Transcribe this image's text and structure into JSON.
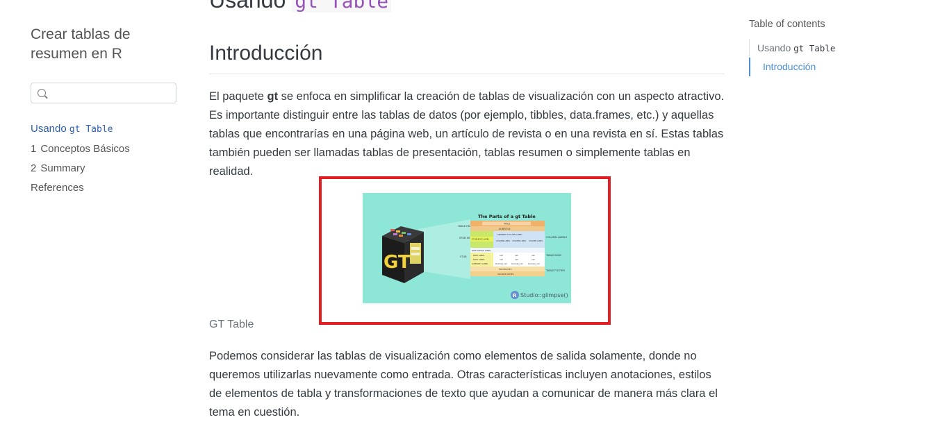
{
  "sidebar": {
    "title": "Crear tablas de resumen en R",
    "search_placeholder": "",
    "items": [
      {
        "prefix": "Usando",
        "code": "gt Table",
        "num": ""
      },
      {
        "num": "1",
        "label": "Conceptos Básicos"
      },
      {
        "num": "2",
        "label": "Summary"
      },
      {
        "num": "",
        "label": "References"
      }
    ]
  },
  "main": {
    "h1_prefix": "Usando",
    "h1_code": "gt Table",
    "h2": "Introducción",
    "p1_a": "El paquete ",
    "p1_bold": "gt",
    "p1_b": " se enfoca en simplificar la creación de tablas de visualización con un aspecto atractivo. Es importante distinguir entre las tablas de datos (por ejemplo, tibbles, data.frames, etc.) y aquellas tablas que encontrarías en una página web, un artículo de revista o en una revista en sí. Estas tablas también pueden ser llamadas tablas de presentación, tablas resumen o simplemente tablas en realidad.",
    "figure": {
      "title": "The Parts of a gt Table",
      "logo": "GT",
      "brand": "Studio::glimpse()",
      "brand_r": "R",
      "row_labels": [
        "TABLE HEADER",
        "STUB HEAD",
        "STUB"
      ],
      "col_labels": [
        "COLUMN LABELS",
        "TABLE BODY",
        "TABLE FOOTER"
      ],
      "title_cell": "TITLE",
      "subtitle_cell": "SUBTITLE",
      "stubhead_cell": "STUBHEAD LABEL",
      "spanner_cell": "SPANNER COLUMN LABEL",
      "col_cells": [
        "COLUMN LABEL",
        "COLUMN LABEL",
        "COLUMN LABEL"
      ],
      "row_group": "ROW GROUP LABEL",
      "stub_rows": [
        "ROW LABEL",
        "ROW LABEL",
        "SUMMARY LABEL"
      ],
      "cell": "cell",
      "summary_cell": "Summary cell",
      "footnotes": "FOOTNOTES",
      "source_notes": "SOURCE NOTES"
    },
    "caption": "GT Table",
    "p2": "Podemos considerar las tablas de visualización como elementos de salida solamente, donde no queremos utilizarlas nuevamente como entrada. Otras características incluyen anotaciones, estilos de elementos de tabla y transformaciones de texto que ayudan a comunicar de manera más clara el tema en cuestión."
  },
  "toc": {
    "title": "Table of contents",
    "items": [
      {
        "prefix": "Usando",
        "code": "gt Table"
      },
      {
        "label": "Introducción"
      }
    ]
  },
  "colors": {
    "accent": "#2c5ea8",
    "frame": "#e31d24",
    "figure_bg": "#8ee6d6"
  }
}
